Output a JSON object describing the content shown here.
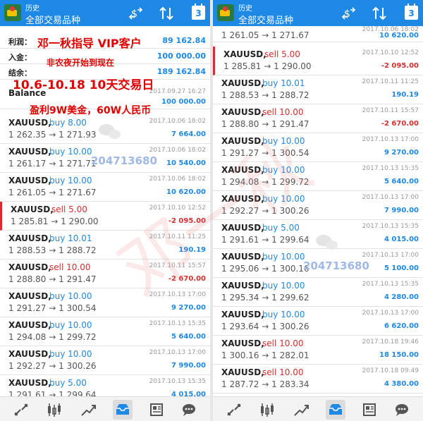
{
  "header": {
    "history_label": "历史",
    "title": "全部交易品种",
    "calendar_number": "3"
  },
  "summary": [
    {
      "label": "利润：",
      "value": "89 162.84"
    },
    {
      "label": "入金：",
      "value": "100 000.00"
    },
    {
      "label": "结余：",
      "value": "189 162.84"
    }
  ],
  "balance": {
    "label": "Balance",
    "date": "2017.09.27 16:27",
    "amount": "100 000.00"
  },
  "overlay": {
    "line1": "邓一秋指导 VIP客户",
    "line2": "非农夜开始到现在",
    "line3": "10.6-10.18    10天交易日",
    "line4": "盈利9W美金，60W人民币"
  },
  "watermark": {
    "number": "204713680",
    "big_text": "邓一秋"
  },
  "left_trades": [
    {
      "symbol": "XAUUSD,",
      "side": "buy 8.00",
      "type": "buy",
      "prices": "1 262.35 → 1 271.93",
      "date": "2017.10.06 18:02",
      "pl": "7 664.00"
    },
    {
      "symbol": "XAUUSD,",
      "side": "buy 10.00",
      "type": "buy",
      "prices": "1 261.17 → 1 271.71",
      "date": "2017.10.06 18:02",
      "pl": "10 540.00"
    },
    {
      "symbol": "XAUUSD,",
      "side": "buy 10.00",
      "type": "buy",
      "prices": "1 261.05 → 1 271.67",
      "date": "2017.10.06 18:02",
      "pl": "10 620.00"
    },
    {
      "symbol": "XAUUSD,",
      "side": "sell 5.00",
      "type": "sell",
      "prices": "1 285.81 → 1 290.00",
      "date": "2017.10.10 12:52",
      "pl": "-2 095.00"
    },
    {
      "symbol": "XAUUSD,",
      "side": "buy 10.01",
      "type": "buy",
      "prices": "1 288.53 → 1 288.72",
      "date": "2017.10.11 11:25",
      "pl": "190.19"
    },
    {
      "symbol": "XAUUSD,",
      "side": "sell 10.00",
      "type": "sell",
      "prices": "1 288.80 → 1 291.47",
      "date": "2017.10.11 15:57",
      "pl": "-2 670.00"
    },
    {
      "symbol": "XAUUSD,",
      "side": "buy 10.00",
      "type": "buy",
      "prices": "1 291.27 → 1 300.54",
      "date": "2017.10.13 17:00",
      "pl": "9 270.00"
    },
    {
      "symbol": "XAUUSD,",
      "side": "buy 10.00",
      "type": "buy",
      "prices": "1 294.08 → 1 299.72",
      "date": "2017.10.13 15:35",
      "pl": "5 640.00"
    },
    {
      "symbol": "XAUUSD,",
      "side": "buy 10.00",
      "type": "buy",
      "prices": "1 292.27 → 1 300.26",
      "date": "2017.10.13 17:00",
      "pl": "7 990.00"
    },
    {
      "symbol": "XAUUSD,",
      "side": "buy 5.00",
      "type": "buy",
      "prices": "1 291.61 → 1 299.64",
      "date": "2017.10.13 15:35",
      "pl": "4 015.00"
    }
  ],
  "right_top_partial": {
    "prices": "1 261.05 → 1 271.67",
    "date": "2017.10.06 18:02",
    "pl": "10 620.00"
  },
  "right_trades": [
    {
      "symbol": "XAUUSD,",
      "side": "sell 5.00",
      "type": "sell",
      "prices": "1 285.81 → 1 290.00",
      "date": "2017.10.10 12:52",
      "pl": "-2 095.00"
    },
    {
      "symbol": "XAUUSD,",
      "side": "buy 10.01",
      "type": "buy",
      "prices": "1 288.53 → 1 288.72",
      "date": "2017.10.11 11:25",
      "pl": "190.19"
    },
    {
      "symbol": "XAUUSD,",
      "side": "sell 10.00",
      "type": "sell",
      "prices": "1 288.80 → 1 291.47",
      "date": "2017.10.11 15:57",
      "pl": "-2 670.00"
    },
    {
      "symbol": "XAUUSD,",
      "side": "buy 10.00",
      "type": "buy",
      "prices": "1 291.27 → 1 300.54",
      "date": "2017.10.13 17:00",
      "pl": "9 270.00"
    },
    {
      "symbol": "XAUUSD,",
      "side": "buy 10.00",
      "type": "buy",
      "prices": "1 294.08 → 1 299.72",
      "date": "2017.10.13 15:35",
      "pl": "5 640.00"
    },
    {
      "symbol": "XAUUSD,",
      "side": "buy 10.00",
      "type": "buy",
      "prices": "1 292.27 → 1 300.26",
      "date": "2017.10.13 17:00",
      "pl": "7 990.00"
    },
    {
      "symbol": "XAUUSD,",
      "side": "buy 5.00",
      "type": "buy",
      "prices": "1 291.61 → 1 299.64",
      "date": "2017.10.13 15:35",
      "pl": "4 015.00"
    },
    {
      "symbol": "XAUUSD,",
      "side": "buy 10.00",
      "type": "buy",
      "prices": "1 295.06 → 1 300.16",
      "date": "2017.10.13 17:00",
      "pl": "5 100.00"
    },
    {
      "symbol": "XAUUSD,",
      "side": "buy 10.00",
      "type": "buy",
      "prices": "1 295.34 → 1 299.62",
      "date": "2017.10.13 15:35",
      "pl": "4 280.00"
    },
    {
      "symbol": "XAUUSD,",
      "side": "buy 10.00",
      "type": "buy",
      "prices": "1 293.64 → 1 300.26",
      "date": "2017.10.13 17:00",
      "pl": "6 620.00"
    },
    {
      "symbol": "XAUUSD,",
      "side": "sell 10.00",
      "type": "sell",
      "prices": "1 300.16 → 1 282.01",
      "date": "2017.10.18 19:46",
      "pl": "18 150.00"
    },
    {
      "symbol": "XAUUSD,",
      "side": "sell 10.00",
      "type": "sell",
      "prices": "1 287.72 → 1 283.34",
      "date": "2017.10.18 09:49",
      "pl": "4 380.00"
    }
  ],
  "footer_icons": [
    "quotes-icon",
    "chart-icon",
    "trade-icon",
    "history-icon",
    "news-icon",
    "chat-icon"
  ],
  "colors": {
    "header_blue": "#1e88e5",
    "buy_blue": "#1e88e5",
    "sell_red": "#d32f2f",
    "overlay_red": "#e00000"
  }
}
